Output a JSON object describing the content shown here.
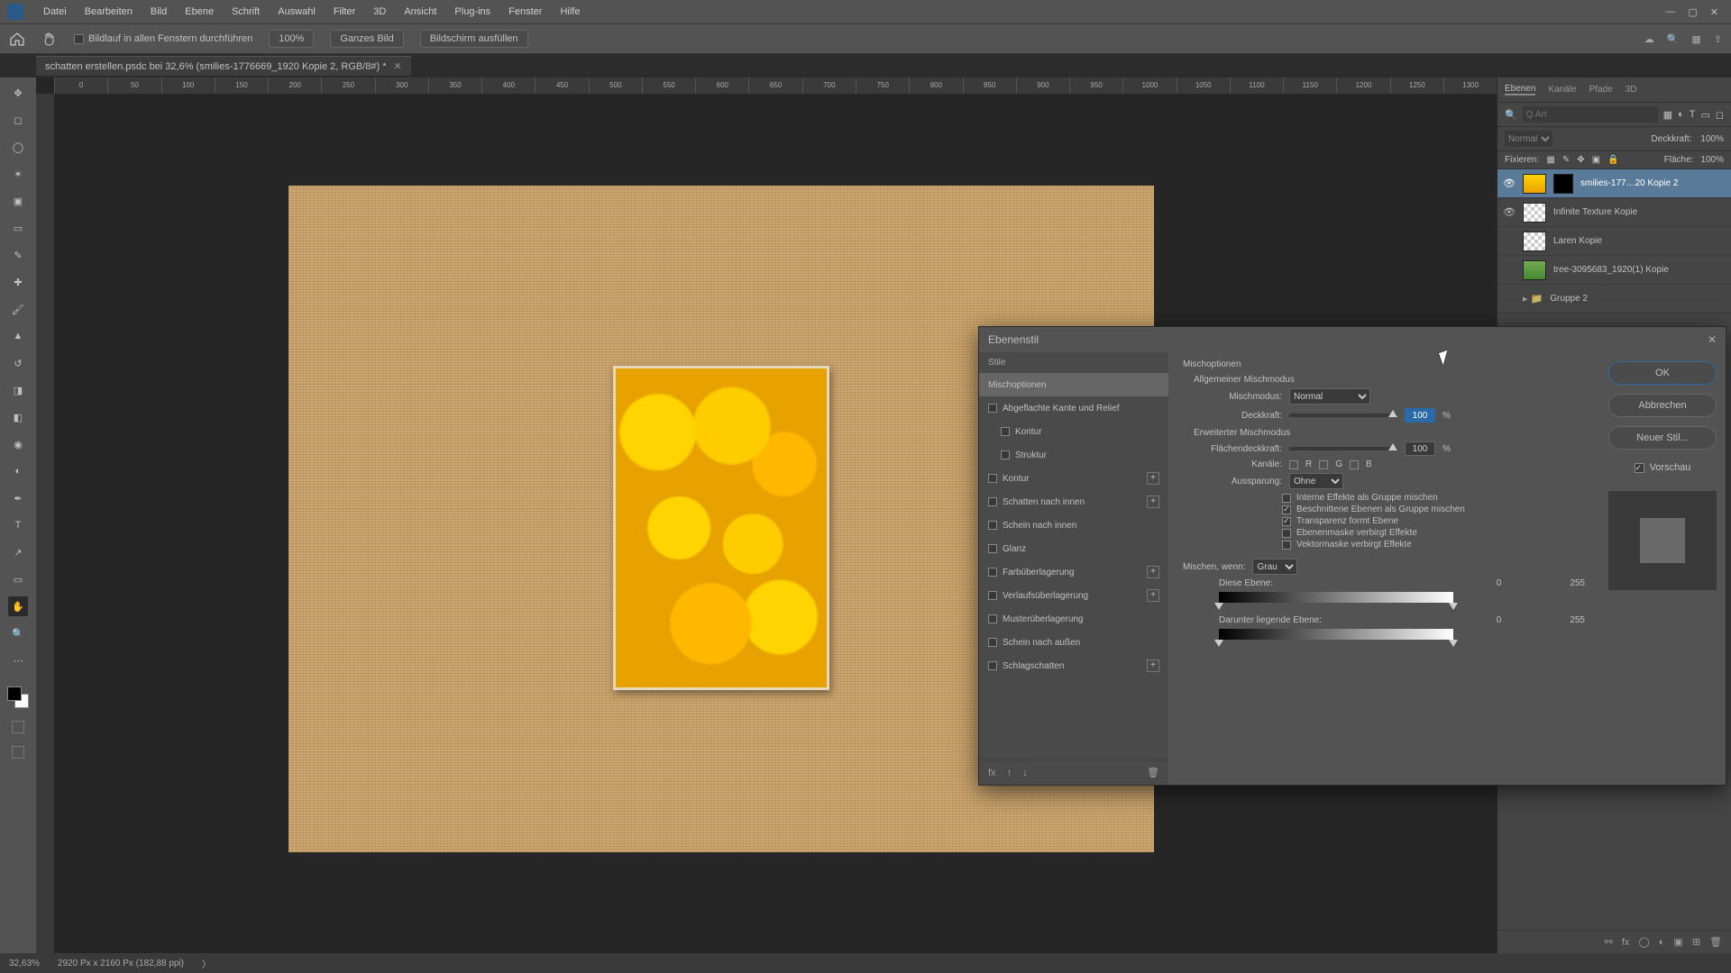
{
  "menubar": {
    "items": [
      "Datei",
      "Bearbeiten",
      "Bild",
      "Ebene",
      "Schrift",
      "Auswahl",
      "Filter",
      "3D",
      "Ansicht",
      "Plug-ins",
      "Fenster",
      "Hilfe"
    ]
  },
  "optionsbar": {
    "scroll_all": "Bildlauf in allen Fenstern durchführen",
    "zoom100": "100%",
    "fit_screen": "Ganzes Bild",
    "fill_screen": "Bildschirm ausfüllen"
  },
  "doctab": {
    "title": "schatten erstellen.psdc bei 32,6% (smilies-1776669_1920 Kopie 2, RGB/8#) *"
  },
  "ruler_ticks": [
    "0",
    "50",
    "100",
    "150",
    "200",
    "250",
    "300",
    "350",
    "400",
    "450",
    "500",
    "550",
    "600",
    "650",
    "700",
    "750",
    "800",
    "850",
    "900",
    "950",
    "1000",
    "1050",
    "1100",
    "1150",
    "1200",
    "1250",
    "1300"
  ],
  "panels": {
    "tabs": [
      "Ebenen",
      "Kanäle",
      "Pfade",
      "3D"
    ],
    "search_placeholder": "Q Art",
    "blend_mode": "Normal",
    "opacity_label": "Deckkraft:",
    "lock_label": "Fixieren:",
    "fill_label": "Fläche:",
    "opacity_val": "100%",
    "fill_val": "100%"
  },
  "layers": [
    {
      "name": "smilies-177…20 Kopie 2",
      "visible": true,
      "selected": true,
      "thumb": "emoji",
      "mask": true
    },
    {
      "name": "Infinite Texture Kopie",
      "visible": true,
      "selected": false,
      "thumb": "checker",
      "mask": false
    },
    {
      "name": "Laren Kopie",
      "visible": false,
      "selected": false,
      "thumb": "checker",
      "mask": false
    },
    {
      "name": "tree-3095683_1920(1) Kopie",
      "visible": false,
      "selected": false,
      "thumb": "tree",
      "mask": false
    },
    {
      "name": "Gruppe 2",
      "visible": false,
      "selected": false,
      "thumb": "group",
      "mask": false
    }
  ],
  "status": {
    "zoom": "32,63%",
    "docinfo": "2920 Px x 2160 Px (182,88 ppi)"
  },
  "dialog": {
    "title": "Ebenenstil",
    "left_header": "Stile",
    "items": [
      {
        "label": "Mischoptionen",
        "selected": true,
        "chk": null,
        "plus": false,
        "indent": 0
      },
      {
        "label": "Abgeflachte Kante und Relief",
        "selected": false,
        "chk": false,
        "plus": false,
        "indent": 0
      },
      {
        "label": "Kontur",
        "selected": false,
        "chk": false,
        "plus": false,
        "indent": 1
      },
      {
        "label": "Struktur",
        "selected": false,
        "chk": false,
        "plus": false,
        "indent": 1
      },
      {
        "label": "Kontur",
        "selected": false,
        "chk": false,
        "plus": true,
        "indent": 0
      },
      {
        "label": "Schatten nach innen",
        "selected": false,
        "chk": false,
        "plus": true,
        "indent": 0
      },
      {
        "label": "Schein nach innen",
        "selected": false,
        "chk": false,
        "plus": false,
        "indent": 0
      },
      {
        "label": "Glanz",
        "selected": false,
        "chk": false,
        "plus": false,
        "indent": 0
      },
      {
        "label": "Farbüberlagerung",
        "selected": false,
        "chk": false,
        "plus": true,
        "indent": 0
      },
      {
        "label": "Verlaufsüberlagerung",
        "selected": false,
        "chk": false,
        "plus": true,
        "indent": 0
      },
      {
        "label": "Musterüberlagerung",
        "selected": false,
        "chk": false,
        "plus": false,
        "indent": 0
      },
      {
        "label": "Schein nach außen",
        "selected": false,
        "chk": false,
        "plus": false,
        "indent": 0
      },
      {
        "label": "Schlagschatten",
        "selected": false,
        "chk": false,
        "plus": true,
        "indent": 0
      }
    ],
    "mid": {
      "header": "Mischoptionen",
      "section1": "Allgemeiner Mischmodus",
      "mode_label": "Mischmodus:",
      "mode_value": "Normal",
      "opacity_label": "Deckkraft:",
      "opacity_value": "100",
      "pct": "%",
      "section2": "Erweiterter Mischmodus",
      "fill_label": "Flächendeckkraft:",
      "fill_value": "100",
      "channels_label": "Kanäle:",
      "ch_r": "R",
      "ch_g": "G",
      "ch_b": "B",
      "knockout_label": "Aussparung:",
      "knockout_value": "Ohne",
      "c1": "Interne Effekte als Gruppe mischen",
      "c2": "Beschnittene Ebenen als Gruppe mischen",
      "c3": "Transparenz formt Ebene",
      "c4": "Ebenenmaske verbirgt Effekte",
      "c5": "Vektormaske verbirgt Effekte",
      "blendif_label": "Mischen, wenn:",
      "blendif_value": "Grau",
      "this_label": "Diese Ebene:",
      "this_lo": "0",
      "this_hi": "255",
      "under_label": "Darunter liegende Ebene:",
      "under_lo": "0",
      "under_hi": "255"
    },
    "right": {
      "ok": "OK",
      "cancel": "Abbrechen",
      "newstyle": "Neuer Stil...",
      "preview": "Vorschau"
    }
  }
}
